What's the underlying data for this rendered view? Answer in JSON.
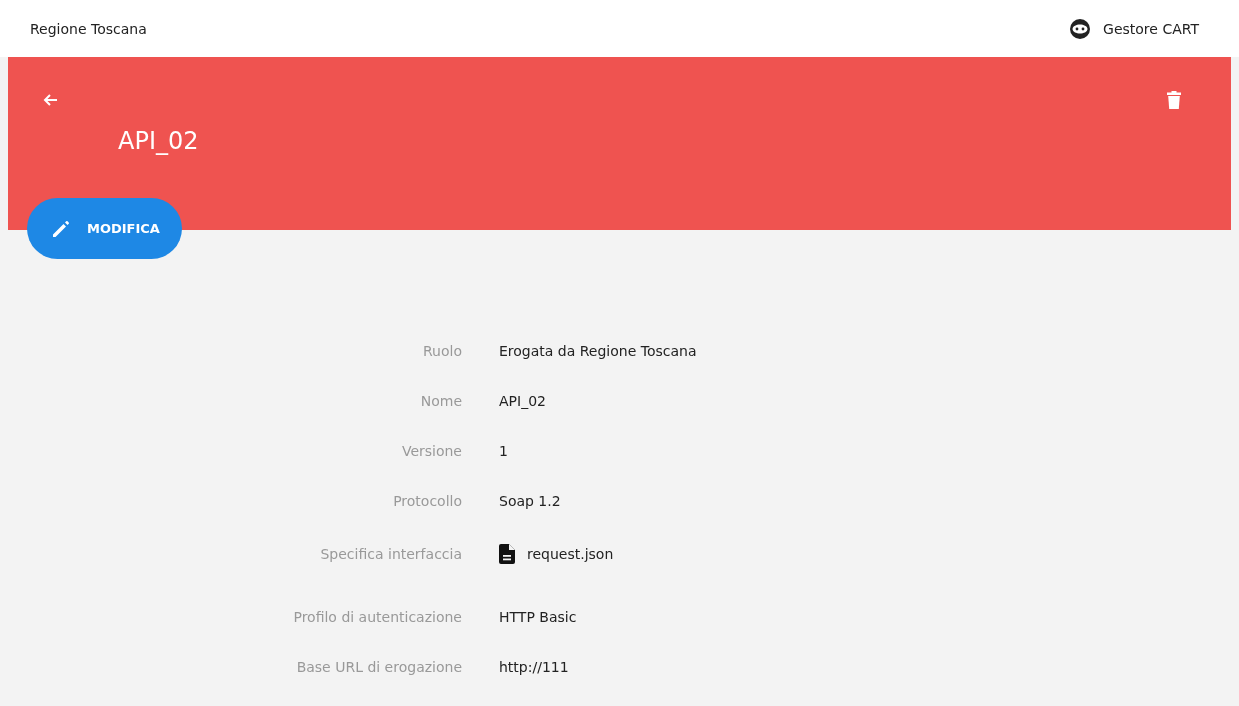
{
  "top_bar": {
    "organization": "Regione Toscana",
    "user": "Gestore CART"
  },
  "header": {
    "title": "API_02",
    "edit_button": "MODIFICA"
  },
  "details": [
    {
      "label": "Ruolo",
      "value": "Erogata da Regione Toscana",
      "kind": "text"
    },
    {
      "label": "Nome",
      "value": "API_02",
      "kind": "text"
    },
    {
      "label": "Versione",
      "value": "1",
      "kind": "text"
    },
    {
      "label": "Protocollo",
      "value": "Soap 1.2",
      "kind": "text"
    },
    {
      "label": "Specifica interfaccia",
      "value": "request.json",
      "kind": "file"
    },
    {
      "label": "Profilo di autenticazione",
      "value": "HTTP Basic",
      "kind": "text"
    },
    {
      "label": "Base URL di erogazione",
      "value": "http://111",
      "kind": "text"
    }
  ]
}
